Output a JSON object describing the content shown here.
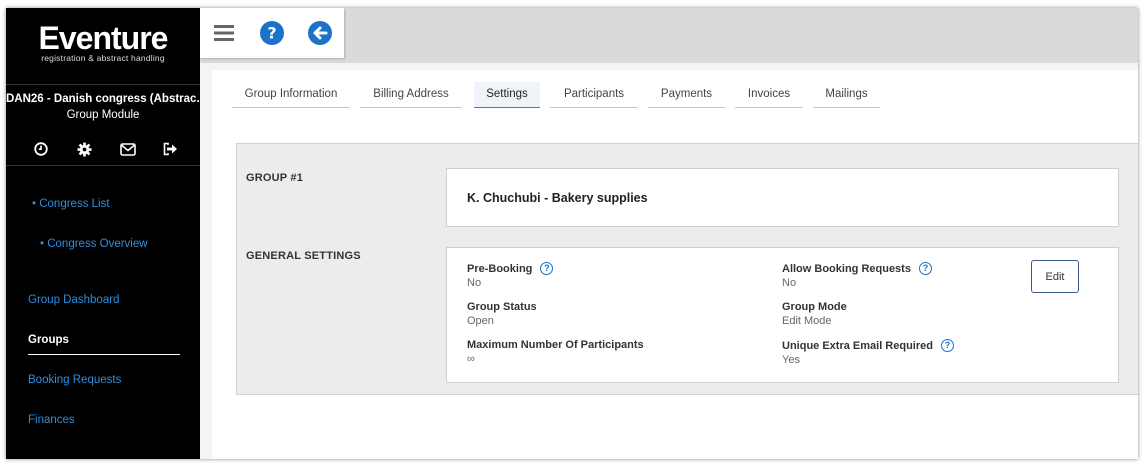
{
  "sidebar": {
    "logo": {
      "main": "Eventure",
      "sub": "registration & abstract handling"
    },
    "congress_name": "DAN26 - Danish congress (Abstrac...",
    "module_name": "Group Module",
    "icons": [
      "clock-icon",
      "gear-icon",
      "mail-icon",
      "logout-icon"
    ],
    "sub_links": [
      "• Congress List",
      "• Congress Overview"
    ],
    "nav": {
      "group_dashboard": "Group Dashboard",
      "groups": "Groups",
      "booking_requests": "Booking Requests",
      "finances": "Finances"
    }
  },
  "topbar": {
    "icons": [
      "menu-icon",
      "help-icon",
      "back-arrow-icon"
    ]
  },
  "tabs": [
    {
      "label": "Group Information",
      "active": false
    },
    {
      "label": "Billing Address",
      "active": false
    },
    {
      "label": "Settings",
      "active": true
    },
    {
      "label": "Participants",
      "active": false
    },
    {
      "label": "Payments",
      "active": false
    },
    {
      "label": "Invoices",
      "active": false
    },
    {
      "label": "Mailings",
      "active": false
    }
  ],
  "group": {
    "section_label": "GROUP #1",
    "name": "K. Chuchubi - Bakery supplies"
  },
  "general": {
    "section_label": "GENERAL SETTINGS",
    "edit_label": "Edit",
    "pre_booking": {
      "label": "Pre-Booking",
      "value": "No"
    },
    "allow_booking_requests": {
      "label": "Allow Booking Requests",
      "value": "No"
    },
    "group_status": {
      "label": "Group Status",
      "value": "Open"
    },
    "group_mode": {
      "label": "Group Mode",
      "value": "Edit Mode"
    },
    "max_participants": {
      "label": "Maximum Number Of Participants",
      "value": "∞"
    },
    "unique_email": {
      "label": "Unique Extra Email Required",
      "value": "Yes"
    }
  },
  "colors": {
    "accent": "#2e8ee0",
    "help_blue": "#1a73c9",
    "sidebar_bg": "#000000"
  }
}
